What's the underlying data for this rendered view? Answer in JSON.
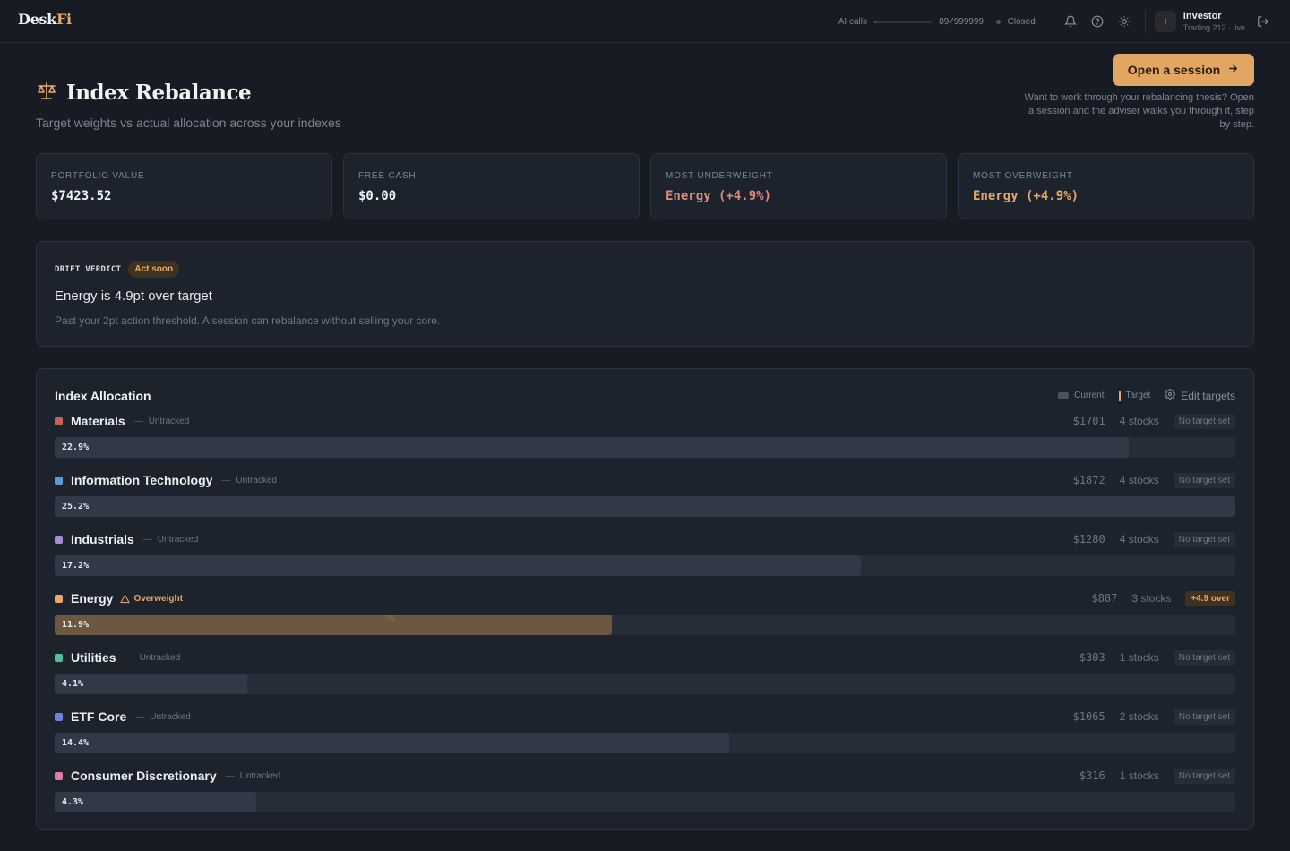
{
  "topbar": {
    "logo_main": "Desk",
    "logo_accent": "Fi",
    "ai_label": "AI calls",
    "ai_usage_fraction": 0.0009,
    "ai_count": "89/999999",
    "status": "Closed",
    "user_initial": "I",
    "user_name": "Investor",
    "user_sub": "Trading 212 · live",
    "icons": [
      "bell-icon",
      "help-icon",
      "sun-icon",
      "logout-icon"
    ]
  },
  "header": {
    "title": "Index Rebalance",
    "subtitle": "Target weights vs actual allocation across your indexes",
    "cta_label": "Open a session",
    "cta_help": "Want to work through your rebalancing thesis? Open a session and the adviser walks you through it, step by step."
  },
  "stats": [
    {
      "label": "PORTFOLIO VALUE",
      "value": "$7423.52",
      "tone": "normal"
    },
    {
      "label": "FREE CASH",
      "value": "$0.00",
      "tone": "normal"
    },
    {
      "label": "MOST UNDERWEIGHT",
      "value": "Energy (+4.9%)",
      "tone": "under"
    },
    {
      "label": "MOST OVERWEIGHT",
      "value": "Energy (+4.9%)",
      "tone": "over"
    }
  ],
  "verdict": {
    "label": "DRIFT VERDICT",
    "badge": "Act soon",
    "title": "Energy is 4.9pt over target",
    "text": "Past your 2pt action threshold. A session can rebalance without selling your core."
  },
  "allocation": {
    "title": "Index Allocation",
    "legend_current": "Current",
    "legend_target": "Target",
    "edit_label": "Edit targets",
    "rows": [
      {
        "name": "Materials",
        "color": "#c8605a",
        "status": "Untracked",
        "warn": false,
        "amount": "$1701",
        "stocks": "4 stocks",
        "tag": "No target set",
        "tag_over": false,
        "pct_label": "22.9%",
        "fill": 0.91
      },
      {
        "name": "Information Technology",
        "color": "#5b9bd5",
        "status": "Untracked",
        "warn": false,
        "amount": "$1872",
        "stocks": "4 stocks",
        "tag": "No target set",
        "tag_over": false,
        "pct_label": "25.2%",
        "fill": 1.0
      },
      {
        "name": "Industrials",
        "color": "#a68bd6",
        "status": "Untracked",
        "warn": false,
        "amount": "$1280",
        "stocks": "4 stocks",
        "tag": "No target set",
        "tag_over": false,
        "pct_label": "17.2%",
        "fill": 0.683
      },
      {
        "name": "Energy",
        "color": "#e8a862",
        "status": "Overweight",
        "warn": true,
        "amount": "$887",
        "stocks": "3 stocks",
        "tag": "+4.9 over",
        "tag_over": true,
        "pct_label": "11.9%",
        "fill": 0.472,
        "target_fill": 0.278,
        "target_label": "7%"
      },
      {
        "name": "Utilities",
        "color": "#4fc29a",
        "status": "Untracked",
        "warn": false,
        "amount": "$303",
        "stocks": "1 stocks",
        "tag": "No target set",
        "tag_over": false,
        "pct_label": "4.1%",
        "fill": 0.163
      },
      {
        "name": "ETF Core",
        "color": "#6d83e0",
        "status": "Untracked",
        "warn": false,
        "amount": "$1065",
        "stocks": "2 stocks",
        "tag": "No target set",
        "tag_over": false,
        "pct_label": "14.4%",
        "fill": 0.571
      },
      {
        "name": "Consumer Discretionary",
        "color": "#e07aa8",
        "status": "Untracked",
        "warn": false,
        "amount": "$316",
        "stocks": "1 stocks",
        "tag": "No target set",
        "tag_over": false,
        "pct_label": "4.3%",
        "fill": 0.171
      }
    ]
  }
}
